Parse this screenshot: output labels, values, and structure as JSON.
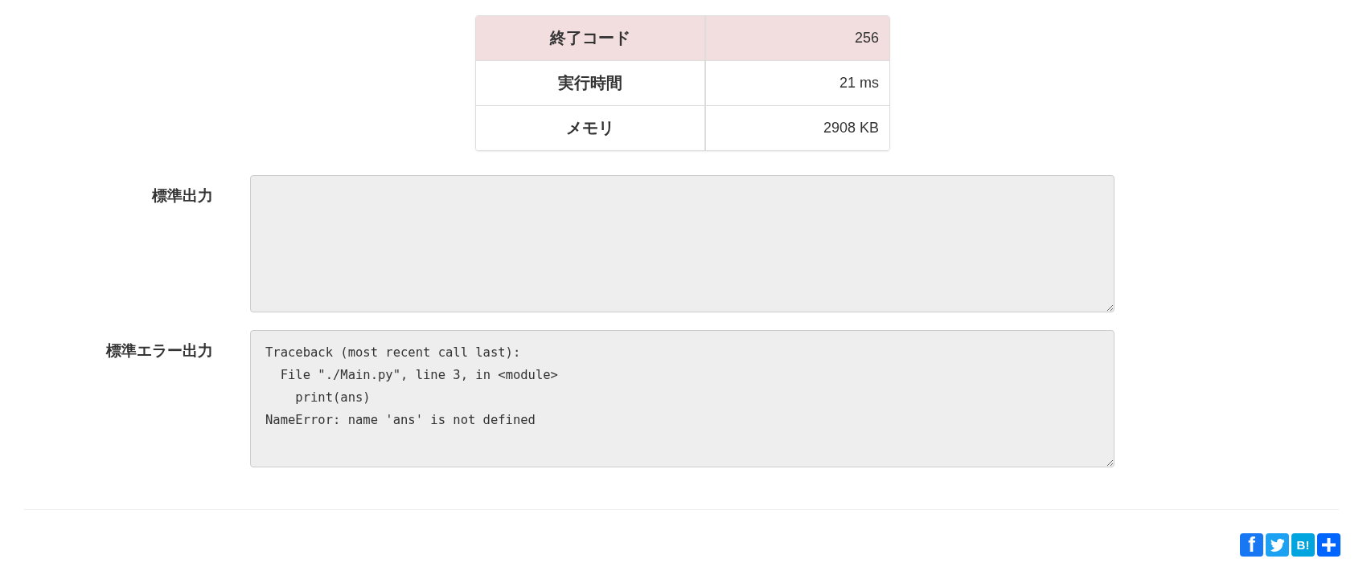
{
  "result_table": [
    {
      "label": "終了コード",
      "value": "256",
      "highlight": true
    },
    {
      "label": "実行時間",
      "value": "21 ms",
      "highlight": false
    },
    {
      "label": "メモリ",
      "value": "2908 KB",
      "highlight": false
    }
  ],
  "outputs": [
    {
      "label": "標準出力"
    },
    {
      "label": "標準エラー出力",
      "value": "Traceback (most recent call last):\n  File \"./Main.py\", line 3, in <module>\n    print(ans)\nNameError: name 'ans' is not defined"
    }
  ],
  "share_buttons": [
    {
      "kind": "facebook",
      "label": "f",
      "color": "#1877f2"
    },
    {
      "kind": "twitter",
      "color": "#1da1f2"
    },
    {
      "kind": "hatena",
      "label": "B!",
      "color": "#00a4de"
    },
    {
      "kind": "plus",
      "color": "#0166ff"
    }
  ]
}
